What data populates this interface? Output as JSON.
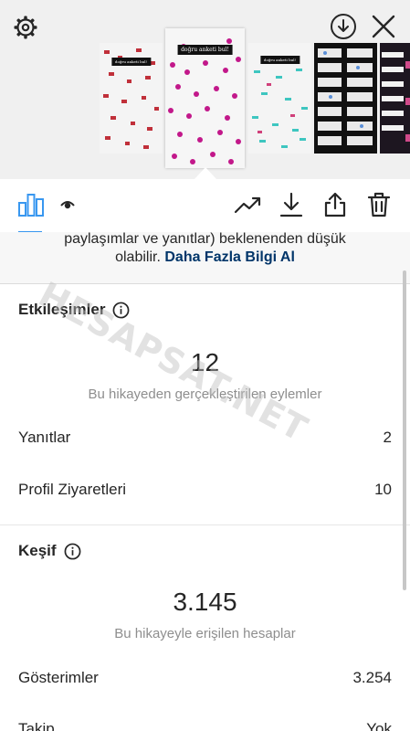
{
  "story": {
    "sticker_text": "doğru anketi bul!"
  },
  "banner": {
    "line1": "paylaşımlar ve yanıtlar) beklenenden düşük",
    "line2_prefix": "olabilir.",
    "learn_more": "Daha Fazla Bilgi Al"
  },
  "interactions": {
    "title": "Etkileşimler",
    "total": "12",
    "total_caption": "Bu hikayeden gerçekleştirilen eylemler",
    "rows": [
      {
        "label": "Yanıtlar",
        "value": "2"
      },
      {
        "label": "Profil Ziyaretleri",
        "value": "10"
      }
    ]
  },
  "discovery": {
    "title": "Keşif",
    "total": "3.145",
    "total_caption": "Bu hikayeyle erişilen hesaplar",
    "rows": [
      {
        "label": "Gösterimler",
        "value": "3.254"
      },
      {
        "label": "Takip",
        "value": "Yok"
      }
    ]
  },
  "watermark": "HESAPSAT.NET",
  "icons": [
    "gear-icon",
    "download-circle-icon",
    "close-icon",
    "insights-icon",
    "eye-icon",
    "trend-icon",
    "download-icon",
    "share-icon",
    "trash-icon",
    "info-icon"
  ],
  "colors": {
    "accent": "#3897f0",
    "link": "#003569",
    "muted": "#8e8e8e"
  }
}
